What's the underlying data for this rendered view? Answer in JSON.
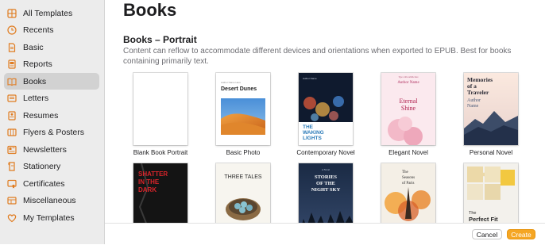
{
  "sidebar": {
    "items": [
      {
        "label": "All Templates",
        "icon": "grid-icon"
      },
      {
        "label": "Recents",
        "icon": "clock-icon"
      },
      {
        "label": "Basic",
        "icon": "document-icon"
      },
      {
        "label": "Reports",
        "icon": "report-icon"
      },
      {
        "label": "Books",
        "icon": "book-icon",
        "selected": true
      },
      {
        "label": "Letters",
        "icon": "letter-icon"
      },
      {
        "label": "Resumes",
        "icon": "resume-icon"
      },
      {
        "label": "Flyers & Posters",
        "icon": "flyer-icon"
      },
      {
        "label": "Newsletters",
        "icon": "newsletter-icon"
      },
      {
        "label": "Stationery",
        "icon": "stationery-icon"
      },
      {
        "label": "Certificates",
        "icon": "certificate-icon"
      },
      {
        "label": "Miscellaneous",
        "icon": "misc-icon"
      },
      {
        "label": "My Templates",
        "icon": "heart-icon"
      }
    ]
  },
  "main": {
    "page_title": "Books",
    "section_title": "Books – Portrait",
    "section_description": "Content can reflow to accommodate different devices and orientations when exported to EPUB. Best for books containing primarily text.",
    "row1": [
      {
        "label": "Blank Book Portrait"
      },
      {
        "label": "Basic Photo",
        "cover_title": "Desert Dunes",
        "cover_caption": "Author Name Here"
      },
      {
        "label": "Contemporary Novel",
        "cover_author": "Author Name",
        "cover_title_l1": "THE",
        "cover_title_l2": "WAKING",
        "cover_title_l3": "LIGHTS"
      },
      {
        "label": "Elegant Novel",
        "cover_tagline": "Type a title subtitle here",
        "cover_author": "Author Name",
        "cover_title_l1": "Eternal",
        "cover_title_l2": "Shine"
      },
      {
        "label": "Personal Novel",
        "cover_title_l1": "Memories",
        "cover_title_l2": "of a",
        "cover_title_l3": "Traveler",
        "cover_author_l1": "Author",
        "cover_author_l2": "Name"
      }
    ],
    "row2": [
      {
        "cover_title_l1": "SHATTER",
        "cover_title_l2": "IN THE",
        "cover_title_l3": "DARK"
      },
      {
        "cover_title": "THREE TALES"
      },
      {
        "cover_kicker": "A Novel",
        "cover_title_l1": "STORIES",
        "cover_title_l2": "OF THE",
        "cover_title_l3": "NIGHT SKY"
      },
      {
        "cover_title_l1": "The",
        "cover_title_l2": "Seasons",
        "cover_title_l3": "of Paris"
      },
      {
        "cover_title_l1": "The",
        "cover_title_l2": "Perfect Fit"
      }
    ]
  },
  "footer": {
    "cancel_label": "Cancel",
    "create_label": "Create"
  },
  "colors": {
    "accent": "#f5a623",
    "sidebar_icon": "#e07b1f",
    "sidebar_bg": "#ececec",
    "selected_bg": "#d2d2d2"
  }
}
